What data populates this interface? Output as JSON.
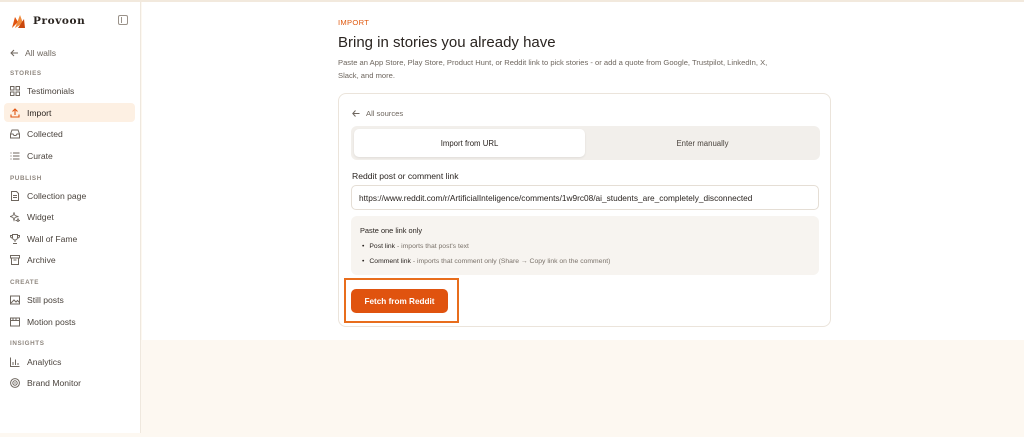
{
  "brand": {
    "name": "Provoon",
    "accent": "#e0530f"
  },
  "sidebar": {
    "back_label": "All walls",
    "sections": [
      {
        "label": "STORIES",
        "items": [
          {
            "label": "Testimonials",
            "icon": "grid-icon"
          },
          {
            "label": "Import",
            "icon": "upload-icon",
            "active": true
          },
          {
            "label": "Collected",
            "icon": "inbox-icon"
          },
          {
            "label": "Curate",
            "icon": "list-icon"
          }
        ]
      },
      {
        "label": "PUBLISH",
        "items": [
          {
            "label": "Collection page",
            "icon": "document-icon"
          },
          {
            "label": "Widget",
            "icon": "sparkle-icon"
          },
          {
            "label": "Wall of Fame",
            "icon": "trophy-icon"
          },
          {
            "label": "Archive",
            "icon": "archive-icon"
          }
        ]
      },
      {
        "label": "CREATE",
        "items": [
          {
            "label": "Still posts",
            "icon": "image-icon"
          },
          {
            "label": "Motion posts",
            "icon": "film-icon"
          }
        ]
      },
      {
        "label": "INSIGHTS",
        "items": [
          {
            "label": "Analytics",
            "icon": "bar-chart-icon"
          },
          {
            "label": "Brand Monitor",
            "icon": "radar-icon"
          }
        ]
      }
    ]
  },
  "main": {
    "eyebrow": "IMPORT",
    "title": "Bring in stories you already have",
    "subtitle": "Paste an App Store, Play Store, Product Hunt, or Reddit link to pick stories - or add a quote from Google, Trustpilot, LinkedIn, X, Slack, and more.",
    "card": {
      "back_label": "All sources",
      "tabs": [
        {
          "label": "Import from URL",
          "active": true
        },
        {
          "label": "Enter manually",
          "active": false
        }
      ],
      "field_label": "Reddit post or comment link",
      "url_value": "https://www.reddit.com/r/ArtificialInteligence/comments/1w9rc08/ai_students_are_completely_disconnected",
      "help": {
        "title": "Paste one link only",
        "bullets": [
          {
            "term": "Post link",
            "text": " - imports that post's text"
          },
          {
            "term": "Comment link",
            "text": " - imports that comment only (Share → Copy link on the comment)"
          }
        ]
      },
      "fetch_button": "Fetch from Reddit"
    }
  }
}
